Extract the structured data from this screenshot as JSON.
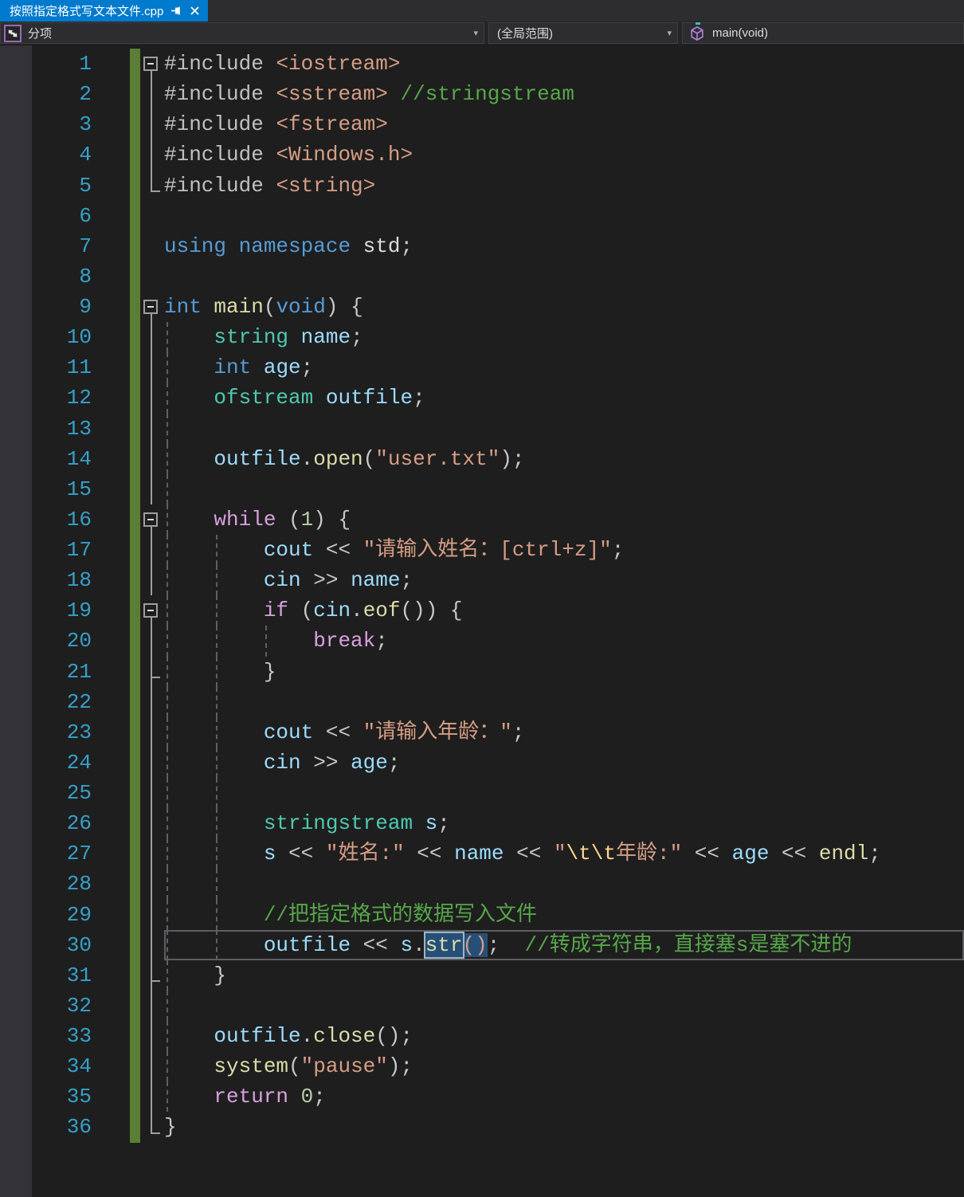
{
  "tab": {
    "title": "按照指定格式写文本文件.cpp",
    "pinned": true,
    "close_icon": "close-icon",
    "pin_icon": "pin-icon",
    "active_color": "#007acc"
  },
  "navbar": {
    "member_label": "分项",
    "scope_label": "(全局范围)",
    "symbol_label": "main(void)",
    "chevron_glyph": "▾",
    "member_icon": "split-arrows-icon",
    "symbol_icon": "method-cube-icon",
    "symbol_icon_color": "#b180d7"
  },
  "colors": {
    "editor_bg": "#1e1e1e",
    "breakpoint_margin": "#333337",
    "line_number": "#35a0c8",
    "change_bar_saved": "#5b7e35",
    "keyword": "#569cd6",
    "control_keyword": "#d8a0df",
    "type": "#4ec9b0",
    "variable": "#9cdcfe",
    "function": "#dcdcaa",
    "string": "#d69d85",
    "escape": "#ffd68f",
    "comment": "#57a64a",
    "number": "#b5cea8",
    "selection_bg": "#264f78"
  },
  "editor": {
    "lines": [
      {
        "n": 1,
        "g": "box",
        "chg": true,
        "guides": [],
        "tokens": [
          [
            "pre",
            "#include "
          ],
          [
            "str",
            "<iostream>"
          ]
        ]
      },
      {
        "n": 2,
        "g": "v",
        "chg": true,
        "guides": [],
        "tokens": [
          [
            "pre",
            "#include "
          ],
          [
            "str",
            "<sstream>"
          ],
          [
            "txt",
            " "
          ],
          [
            "com",
            "//stringstream"
          ]
        ]
      },
      {
        "n": 3,
        "g": "v",
        "chg": true,
        "guides": [],
        "tokens": [
          [
            "pre",
            "#include "
          ],
          [
            "str",
            "<fstream>"
          ]
        ]
      },
      {
        "n": 4,
        "g": "v",
        "chg": true,
        "guides": [],
        "tokens": [
          [
            "pre",
            "#include "
          ],
          [
            "str",
            "<Windows.h>"
          ]
        ]
      },
      {
        "n": 5,
        "g": "end",
        "chg": true,
        "guides": [],
        "tokens": [
          [
            "pre",
            "#include "
          ],
          [
            "str",
            "<string>"
          ]
        ]
      },
      {
        "n": 6,
        "g": "",
        "chg": true,
        "guides": [],
        "tokens": []
      },
      {
        "n": 7,
        "g": "",
        "chg": true,
        "guides": [],
        "tokens": [
          [
            "kw",
            "using"
          ],
          [
            "txt",
            " "
          ],
          [
            "kw",
            "namespace"
          ],
          [
            "txt",
            " "
          ],
          [
            "txt",
            "std"
          ],
          [
            "pun",
            ";"
          ]
        ]
      },
      {
        "n": 8,
        "g": "",
        "chg": true,
        "guides": [],
        "tokens": []
      },
      {
        "n": 9,
        "g": "box",
        "chg": true,
        "guides": [],
        "tokens": [
          [
            "kw",
            "int"
          ],
          [
            "txt",
            " "
          ],
          [
            "fn",
            "main"
          ],
          [
            "pun",
            "("
          ],
          [
            "kw",
            "void"
          ],
          [
            "pun",
            ") {"
          ]
        ]
      },
      {
        "n": 10,
        "g": "v",
        "chg": true,
        "guides": [
          0
        ],
        "tokens": [
          [
            "txt",
            "    "
          ],
          [
            "type",
            "string"
          ],
          [
            "txt",
            " "
          ],
          [
            "var",
            "name"
          ],
          [
            "pun",
            ";"
          ]
        ]
      },
      {
        "n": 11,
        "g": "v",
        "chg": true,
        "guides": [
          0
        ],
        "tokens": [
          [
            "txt",
            "    "
          ],
          [
            "kw",
            "int"
          ],
          [
            "txt",
            " "
          ],
          [
            "var",
            "age"
          ],
          [
            "pun",
            ";"
          ]
        ]
      },
      {
        "n": 12,
        "g": "v",
        "chg": true,
        "guides": [
          0
        ],
        "tokens": [
          [
            "txt",
            "    "
          ],
          [
            "type",
            "ofstream"
          ],
          [
            "txt",
            " "
          ],
          [
            "var",
            "outfile"
          ],
          [
            "pun",
            ";"
          ]
        ]
      },
      {
        "n": 13,
        "g": "v",
        "chg": true,
        "guides": [
          0
        ],
        "tokens": []
      },
      {
        "n": 14,
        "g": "v",
        "chg": true,
        "guides": [
          0
        ],
        "tokens": [
          [
            "txt",
            "    "
          ],
          [
            "var",
            "outfile"
          ],
          [
            "pun",
            "."
          ],
          [
            "fn",
            "open"
          ],
          [
            "pun",
            "("
          ],
          [
            "str",
            "\"user.txt\""
          ],
          [
            "pun",
            ");"
          ]
        ]
      },
      {
        "n": 15,
        "g": "v",
        "chg": true,
        "guides": [
          0
        ],
        "tokens": []
      },
      {
        "n": 16,
        "g": "box",
        "chg": true,
        "guides": [
          0
        ],
        "tokens": [
          [
            "txt",
            "    "
          ],
          [
            "ctrl",
            "while"
          ],
          [
            "txt",
            " "
          ],
          [
            "pun",
            "("
          ],
          [
            "num",
            "1"
          ],
          [
            "pun",
            ") {"
          ]
        ]
      },
      {
        "n": 17,
        "g": "v",
        "chg": true,
        "guides": [
          0,
          1
        ],
        "tokens": [
          [
            "txt",
            "        "
          ],
          [
            "var",
            "cout"
          ],
          [
            "pun",
            " << "
          ],
          [
            "str",
            "\"请输入姓名：[ctrl+z]\""
          ],
          [
            "pun",
            ";"
          ]
        ]
      },
      {
        "n": 18,
        "g": "v",
        "chg": true,
        "guides": [
          0,
          1
        ],
        "tokens": [
          [
            "txt",
            "        "
          ],
          [
            "var",
            "cin"
          ],
          [
            "pun",
            " >> "
          ],
          [
            "var",
            "name"
          ],
          [
            "pun",
            ";"
          ]
        ]
      },
      {
        "n": 19,
        "g": "box",
        "chg": true,
        "guides": [
          0,
          1
        ],
        "tokens": [
          [
            "txt",
            "        "
          ],
          [
            "ctrl",
            "if"
          ],
          [
            "txt",
            " "
          ],
          [
            "pun",
            "("
          ],
          [
            "var",
            "cin"
          ],
          [
            "pun",
            "."
          ],
          [
            "fn",
            "eof"
          ],
          [
            "pun",
            "()) {"
          ]
        ]
      },
      {
        "n": 20,
        "g": "v",
        "chg": true,
        "guides": [
          0,
          1,
          2
        ],
        "tokens": [
          [
            "txt",
            "            "
          ],
          [
            "ctrl",
            "break"
          ],
          [
            "pun",
            ";"
          ]
        ]
      },
      {
        "n": 21,
        "g": "vend",
        "chg": true,
        "guides": [
          0,
          1
        ],
        "tokens": [
          [
            "txt",
            "        "
          ],
          [
            "pun",
            "}"
          ]
        ]
      },
      {
        "n": 22,
        "g": "v",
        "chg": true,
        "guides": [
          0,
          1
        ],
        "tokens": []
      },
      {
        "n": 23,
        "g": "v",
        "chg": true,
        "guides": [
          0,
          1
        ],
        "tokens": [
          [
            "txt",
            "        "
          ],
          [
            "var",
            "cout"
          ],
          [
            "pun",
            " << "
          ],
          [
            "str",
            "\"请输入年龄："
          ],
          [
            "str",
            "\""
          ],
          [
            "pun",
            ";"
          ]
        ]
      },
      {
        "n": 24,
        "g": "v",
        "chg": true,
        "guides": [
          0,
          1
        ],
        "tokens": [
          [
            "txt",
            "        "
          ],
          [
            "var",
            "cin"
          ],
          [
            "pun",
            " >> "
          ],
          [
            "var",
            "age"
          ],
          [
            "pun",
            ";"
          ]
        ]
      },
      {
        "n": 25,
        "g": "v",
        "chg": true,
        "guides": [
          0,
          1
        ],
        "tokens": []
      },
      {
        "n": 26,
        "g": "v",
        "chg": true,
        "guides": [
          0,
          1
        ],
        "tokens": [
          [
            "txt",
            "        "
          ],
          [
            "type",
            "stringstream"
          ],
          [
            "txt",
            " "
          ],
          [
            "var",
            "s"
          ],
          [
            "pun",
            ";"
          ]
        ]
      },
      {
        "n": 27,
        "g": "v",
        "chg": true,
        "guides": [
          0,
          1
        ],
        "tokens": [
          [
            "txt",
            "        "
          ],
          [
            "var",
            "s"
          ],
          [
            "pun",
            " << "
          ],
          [
            "str",
            "\"姓名:\""
          ],
          [
            "pun",
            " << "
          ],
          [
            "var",
            "name"
          ],
          [
            "pun",
            " << "
          ],
          [
            "str",
            "\""
          ],
          [
            "esc",
            "\\t\\t"
          ],
          [
            "str",
            "年龄:\""
          ],
          [
            "pun",
            " << "
          ],
          [
            "var",
            "age"
          ],
          [
            "pun",
            " << "
          ],
          [
            "fn",
            "endl"
          ],
          [
            "pun",
            ";"
          ]
        ]
      },
      {
        "n": 28,
        "g": "v",
        "chg": true,
        "guides": [
          0,
          1
        ],
        "tokens": []
      },
      {
        "n": 29,
        "g": "v",
        "chg": true,
        "guides": [
          0,
          1
        ],
        "tokens": [
          [
            "txt",
            "        "
          ],
          [
            "com",
            "//把指定格式的数据写入文件"
          ]
        ]
      },
      {
        "n": 30,
        "g": "v",
        "chg": true,
        "current": true,
        "guides": [
          0,
          1
        ],
        "tokens": [
          [
            "txt",
            "        "
          ],
          [
            "var",
            "outfile"
          ],
          [
            "pun",
            " << "
          ],
          [
            "var",
            "s"
          ],
          [
            "pun",
            "."
          ],
          [
            "fnsel",
            "str"
          ],
          [
            "punsel",
            "()"
          ],
          [
            "pun",
            ";  "
          ],
          [
            "com",
            "//转成字符串，直接塞s是塞不进的"
          ]
        ]
      },
      {
        "n": 31,
        "g": "vend",
        "chg": true,
        "guides": [
          0
        ],
        "tokens": [
          [
            "txt",
            "    "
          ],
          [
            "pun",
            "}"
          ]
        ]
      },
      {
        "n": 32,
        "g": "v",
        "chg": true,
        "guides": [
          0
        ],
        "tokens": []
      },
      {
        "n": 33,
        "g": "v",
        "chg": true,
        "guides": [
          0
        ],
        "tokens": [
          [
            "txt",
            "    "
          ],
          [
            "var",
            "outfile"
          ],
          [
            "pun",
            "."
          ],
          [
            "fn",
            "close"
          ],
          [
            "pun",
            "();"
          ]
        ]
      },
      {
        "n": 34,
        "g": "v",
        "chg": true,
        "guides": [
          0
        ],
        "tokens": [
          [
            "txt",
            "    "
          ],
          [
            "fn",
            "system"
          ],
          [
            "pun",
            "("
          ],
          [
            "str",
            "\"pause\""
          ],
          [
            "pun",
            ");"
          ]
        ]
      },
      {
        "n": 35,
        "g": "v",
        "chg": true,
        "guides": [
          0
        ],
        "tokens": [
          [
            "txt",
            "    "
          ],
          [
            "ctrl",
            "return"
          ],
          [
            "txt",
            " "
          ],
          [
            "num",
            "0"
          ],
          [
            "pun",
            ";"
          ]
        ]
      },
      {
        "n": 36,
        "g": "end",
        "chg": true,
        "guides": [],
        "tokens": [
          [
            "pun",
            "}"
          ]
        ]
      }
    ]
  }
}
